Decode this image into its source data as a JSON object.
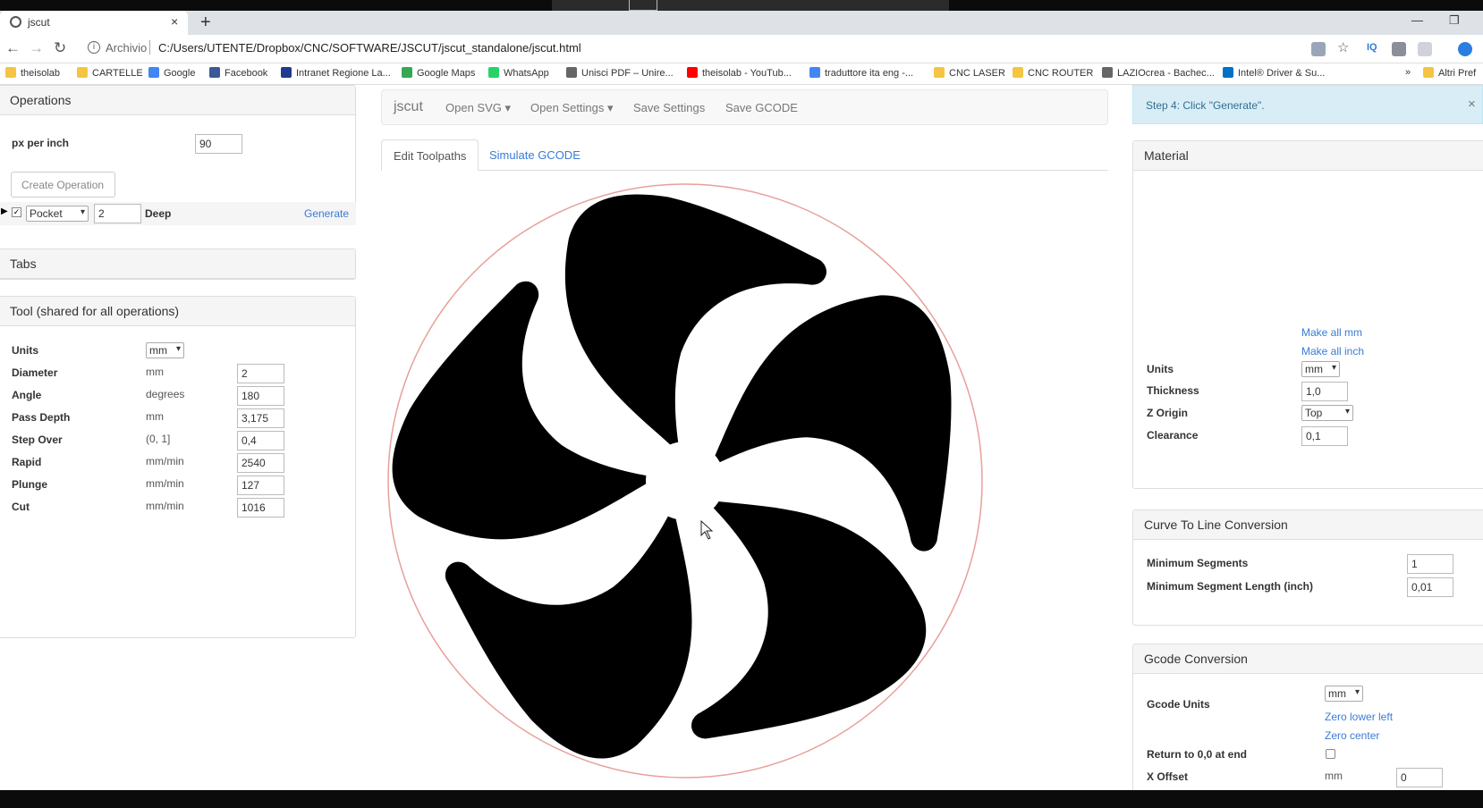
{
  "browser": {
    "tab_title": "jscut",
    "new_tab": "+",
    "close_tab": "×",
    "url_scheme": "Archivio",
    "url": "C:/Users/UTENTE/Dropbox/CNC/SOFTWARE/JSCUT/jscut_standalone/jscut.html",
    "bookmarks": [
      "theisolab",
      "CARTELLE",
      "Google",
      "Facebook",
      "Intranet Regione La...",
      "Google Maps",
      "WhatsApp",
      "Unisci PDF – Unire...",
      "theisolab - YouTub...",
      "traduttore ita eng -...",
      "CNC LASER",
      "CNC ROUTER",
      "LAZIOcrea - Bachec...",
      "Intel® Driver & Su..."
    ],
    "more_bookmarks": "»",
    "other_bookmarks": "Altri Pref"
  },
  "operations": {
    "title": "Operations",
    "px_per_inch_label": "px per inch",
    "px_per_inch_value": "90",
    "create_button": "Create Operation",
    "op_type": "Pocket",
    "op_depth": "2",
    "op_deep_label": "Deep",
    "generate_link": "Generate"
  },
  "tabs_panel": {
    "title": "Tabs"
  },
  "tool": {
    "title": "Tool (shared for all operations)",
    "units_label": "Units",
    "units_value": "mm",
    "rows": [
      {
        "label": "Diameter",
        "unit": "mm",
        "value": "2"
      },
      {
        "label": "Angle",
        "unit": "degrees",
        "value": "180"
      },
      {
        "label": "Pass Depth",
        "unit": "mm",
        "value": "3,175"
      },
      {
        "label": "Step Over",
        "unit": "(0, 1]",
        "value": "0,4"
      },
      {
        "label": "Rapid",
        "unit": "mm/min",
        "value": "2540"
      },
      {
        "label": "Plunge",
        "unit": "mm/min",
        "value": "127"
      },
      {
        "label": "Cut",
        "unit": "mm/min",
        "value": "1016"
      }
    ]
  },
  "navbar": {
    "brand": "jscut",
    "open_svg": "Open SVG",
    "open_settings": "Open Settings",
    "save_settings": "Save Settings",
    "save_gcode": "Save GCODE"
  },
  "view_tabs": {
    "edit": "Edit Toolpaths",
    "simulate": "Simulate GCODE"
  },
  "alert": {
    "message": "Step 4: Click \"Generate\".",
    "close": "×"
  },
  "material": {
    "title": "Material",
    "make_all_mm": "Make all mm",
    "make_all_inch": "Make all inch",
    "units_label": "Units",
    "units_value": "mm",
    "thickness_label": "Thickness",
    "thickness_value": "1,0",
    "zorigin_label": "Z Origin",
    "zorigin_value": "Top",
    "clearance_label": "Clearance",
    "clearance_value": "0,1"
  },
  "curve": {
    "title": "Curve To Line Conversion",
    "min_segments_label": "Minimum Segments",
    "min_segments_value": "1",
    "min_seg_len_label": "Minimum Segment Length (inch)",
    "min_seg_len_value": "0,01"
  },
  "gcode": {
    "title": "Gcode Conversion",
    "units_label": "Gcode Units",
    "units_value": "mm",
    "zero_lower_left": "Zero lower left",
    "zero_center": "Zero center",
    "return_label": "Return to 0,0 at end",
    "xoffset_label": "X Offset",
    "xoffset_unit": "mm",
    "xoffset_value": "0"
  },
  "colors": {
    "link": "#3a7bd5",
    "alert_bg": "#d9edf7",
    "circle_outline": "#e8a09a"
  }
}
